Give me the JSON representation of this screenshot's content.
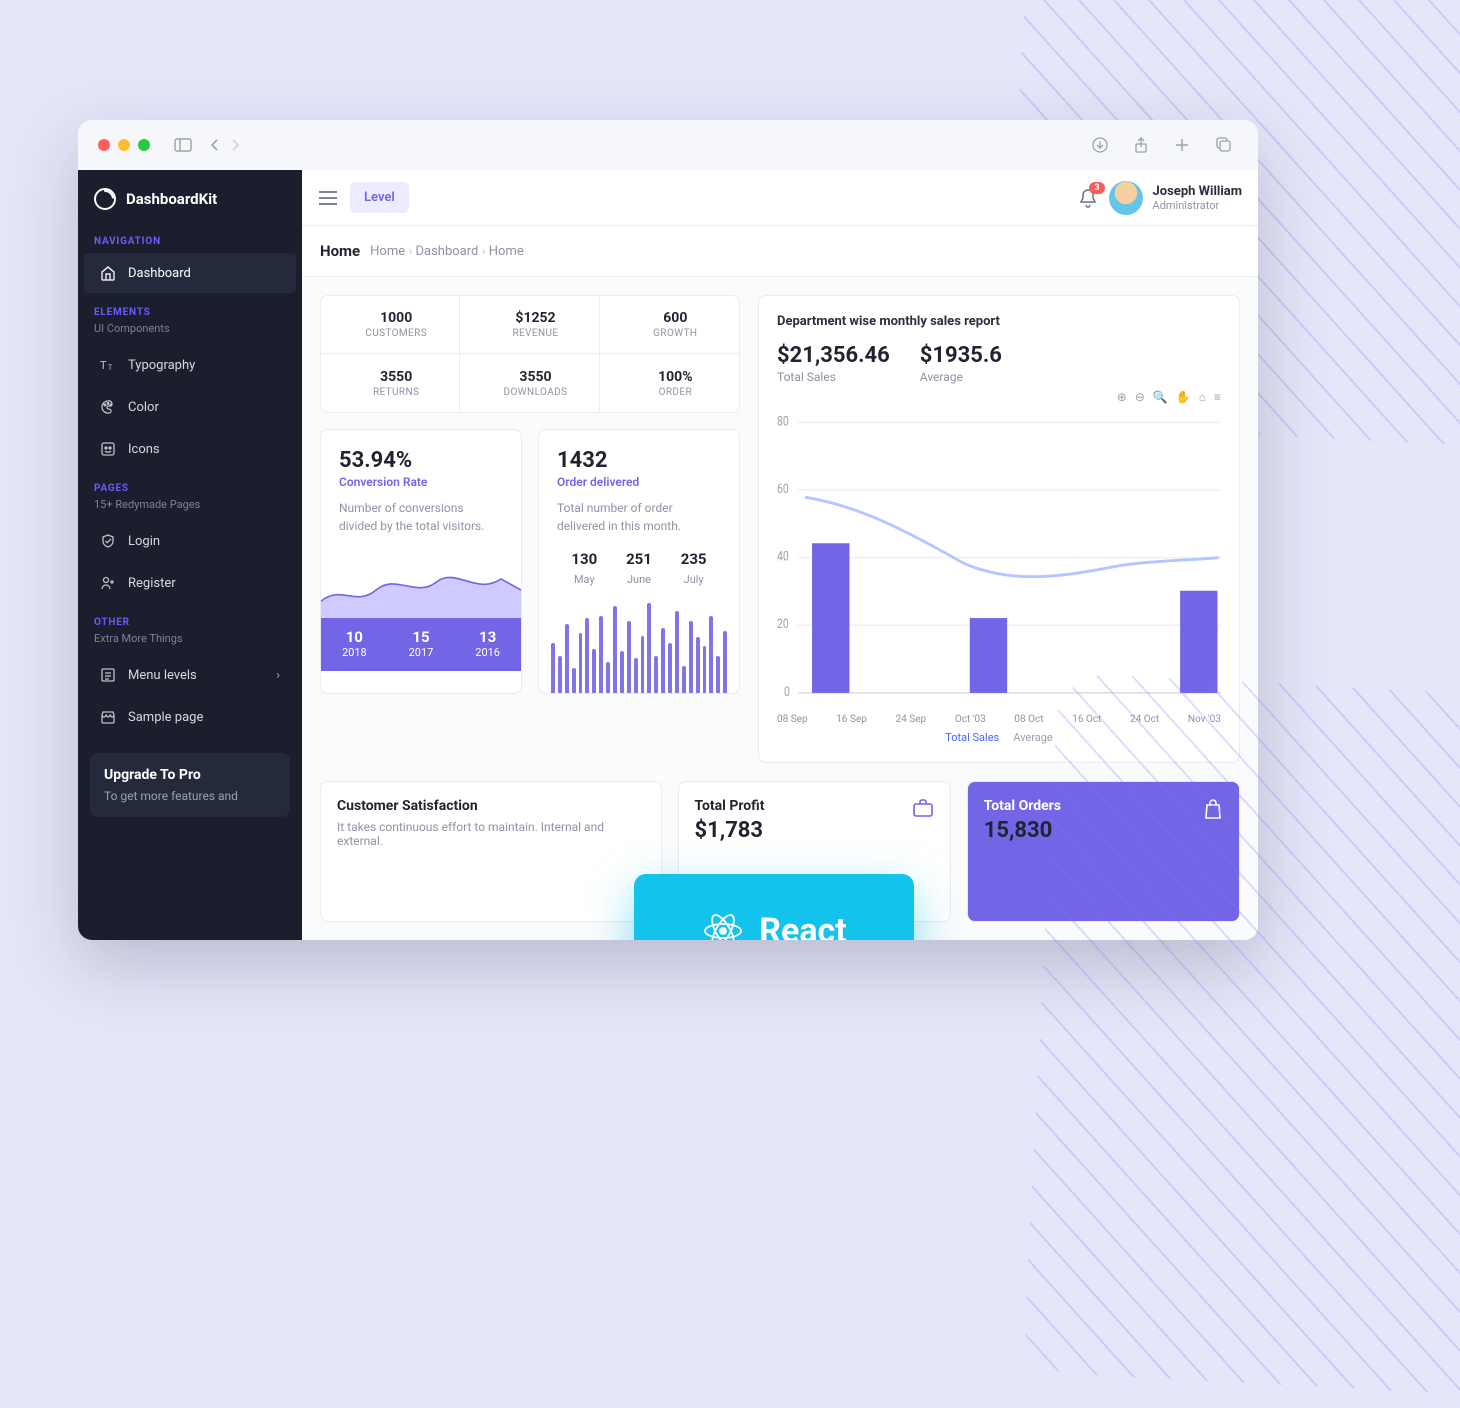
{
  "window": {
    "title": "DashboardKit"
  },
  "topbar": {
    "level": "Level",
    "notifications": 3,
    "user_name": "Joseph William",
    "user_role": "Administrator"
  },
  "breadcrumb": {
    "page": "Home",
    "path": [
      "Home",
      "Dashboard",
      "Home"
    ]
  },
  "sidebar": {
    "sections": [
      {
        "title": "NAVIGATION",
        "subtitle": "",
        "items": [
          {
            "icon": "home-icon",
            "label": "Dashboard",
            "active": true
          }
        ]
      },
      {
        "title": "ELEMENTS",
        "subtitle": "UI Components",
        "items": [
          {
            "icon": "type-icon",
            "label": "Typography"
          },
          {
            "icon": "palette-icon",
            "label": "Color"
          },
          {
            "icon": "emoji-icon",
            "label": "Icons"
          }
        ]
      },
      {
        "title": "PAGES",
        "subtitle": "15+ Redymade Pages",
        "items": [
          {
            "icon": "shield-icon",
            "label": "Login"
          },
          {
            "icon": "person-add-icon",
            "label": "Register"
          }
        ]
      },
      {
        "title": "OTHER",
        "subtitle": "Extra More Things",
        "items": [
          {
            "icon": "list-icon",
            "label": "Menu levels",
            "chevron": true
          },
          {
            "icon": "store-icon",
            "label": "Sample page"
          }
        ]
      }
    ],
    "upgrade": {
      "title": "Upgrade To Pro",
      "subtitle": "To get more features and"
    }
  },
  "stats": [
    {
      "icon": "people-icon",
      "value": "1000",
      "label": "CUSTOMERS"
    },
    {
      "icon": "globe-icon",
      "value": "$1252",
      "label": "REVENUE"
    },
    {
      "icon": "calendar-plus-icon",
      "value": "600",
      "label": "GROWTH"
    },
    {
      "icon": "returns-icon",
      "value": "3550",
      "label": "RETURNS"
    },
    {
      "icon": "cloud-download-icon",
      "value": "3550",
      "label": "DOWNLOADS"
    },
    {
      "icon": "cart-icon",
      "value": "100%",
      "label": "ORDER"
    }
  ],
  "conversion": {
    "value": "53.94%",
    "label": "Conversion Rate",
    "desc": "Number of conversions divided by the total visitors.",
    "years": [
      {
        "n": "10",
        "y": "2018"
      },
      {
        "n": "15",
        "y": "2017"
      },
      {
        "n": "13",
        "y": "2016"
      }
    ]
  },
  "orders": {
    "value": "1432",
    "label": "Order delivered",
    "desc": "Total number of order delivered in this month.",
    "months": [
      {
        "n": "130",
        "m": "May"
      },
      {
        "n": "251",
        "m": "June"
      },
      {
        "n": "235",
        "m": "July"
      }
    ],
    "spark": [
      40,
      30,
      55,
      20,
      48,
      60,
      35,
      62,
      25,
      70,
      34,
      58,
      28,
      46,
      72,
      30,
      52,
      40,
      66,
      22,
      58,
      45,
      38,
      62,
      30,
      50
    ]
  },
  "report": {
    "title": "Department wise monthly sales report",
    "total": "$21,356.46",
    "total_label": "Total Sales",
    "avg": "$1935.6",
    "avg_label": "Average",
    "legend": {
      "a": "Total Sales",
      "b": "Average"
    }
  },
  "bottom": {
    "sat": {
      "title": "Customer Satisfaction",
      "desc": "It takes continuous effort to maintain. Internal and external."
    },
    "profit": {
      "title": "Total Profit",
      "value": "$1,783"
    },
    "orders": {
      "title": "Total Orders",
      "value": "15,830"
    }
  },
  "react": "React",
  "chart_data": {
    "type": "bar",
    "title": "Department wise monthly sales report",
    "categories": [
      "08 Sep",
      "16 Sep",
      "24 Sep",
      "Oct '03",
      "08 Oct",
      "16 Oct",
      "24 Oct",
      "Nov '03"
    ],
    "ylim": [
      0,
      80
    ],
    "series": [
      {
        "name": "Total Sales",
        "type": "bar",
        "values": [
          44,
          null,
          null,
          22,
          null,
          null,
          null,
          30
        ]
      },
      {
        "name": "Average",
        "type": "line",
        "values": [
          58,
          55,
          48,
          40,
          36,
          36,
          38,
          40
        ]
      }
    ]
  }
}
